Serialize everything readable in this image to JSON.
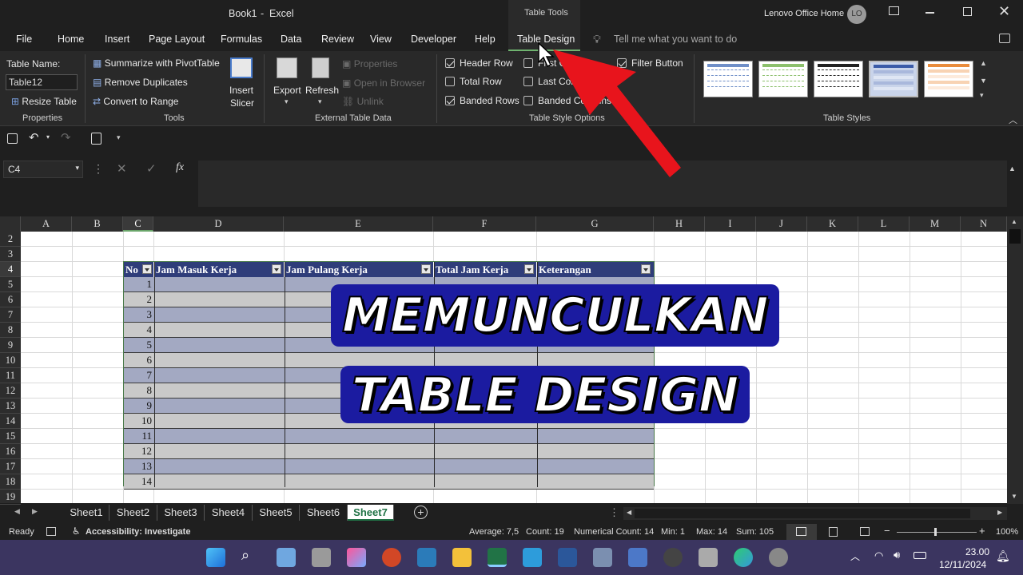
{
  "title": {
    "doc": "Book1",
    "sep": "-",
    "app": "Excel",
    "tools": "Table Tools",
    "account": "Lenovo Office Home",
    "avatar": "LO"
  },
  "menu": [
    "File",
    "Home",
    "Insert",
    "Page Layout",
    "Formulas",
    "Data",
    "Review",
    "View",
    "Developer",
    "Help",
    "Table Design"
  ],
  "tellme": "Tell me what you want to do",
  "ribbon": {
    "table_name_label": "Table Name:",
    "table_name_value": "Table12",
    "resize_table": "Resize Table",
    "summarize": "Summarize with PivotTable",
    "remove_dup": "Remove Duplicates",
    "convert": "Convert to Range",
    "insert_slicer_1": "Insert",
    "insert_slicer_2": "Slicer",
    "export": "Export",
    "refresh": "Refresh",
    "properties": "Properties",
    "open_browser": "Open in Browser",
    "unlink": "Unlink",
    "header_row": "Header Row",
    "total_row": "Total Row",
    "banded_rows": "Banded Rows",
    "first_column": "First Column",
    "last_column": "Last Column",
    "banded_columns": "Banded Columns",
    "filter_button": "Filter Button",
    "groups": {
      "properties": "Properties",
      "tools": "Tools",
      "external": "External Table Data",
      "style_options": "Table Style Options",
      "styles": "Table Styles"
    }
  },
  "namebox": "C4",
  "fx": "fx",
  "columns": [
    "A",
    "B",
    "C",
    "D",
    "E",
    "F",
    "G",
    "H",
    "I",
    "J",
    "K",
    "L",
    "M",
    "N"
  ],
  "rows": [
    "2",
    "3",
    "4",
    "5",
    "6",
    "7",
    "8",
    "9",
    "10",
    "11",
    "12",
    "13",
    "14",
    "15",
    "16",
    "17",
    "18",
    "19"
  ],
  "table": {
    "headers": [
      "No",
      "Jam Masuk Kerja",
      "Jam Pulang Kerja",
      "Total Jam Kerja",
      "Keterangan"
    ],
    "numbers": [
      "1",
      "2",
      "3",
      "4",
      "5",
      "6",
      "7",
      "8",
      "9",
      "10",
      "11",
      "12",
      "13",
      "14"
    ]
  },
  "overlay": {
    "line1": "MEMUNCULKAN",
    "line2": "TABLE DESIGN"
  },
  "sheets": [
    "Sheet1",
    "Sheet2",
    "Sheet3",
    "Sheet4",
    "Sheet5",
    "Sheet6",
    "Sheet7"
  ],
  "active_sheet": "Sheet7",
  "status": {
    "ready": "Ready",
    "accessibility": "Accessibility: Investigate",
    "average": "Average: 7,5",
    "count": "Count: 19",
    "numerical_count": "Numerical Count: 14",
    "min": "Min: 1",
    "max": "Max: 14",
    "sum": "Sum: 105",
    "zoom": "100%"
  },
  "taskbar": {
    "time": "23.00",
    "date": "12/11/2024"
  },
  "colors": {
    "header_blue": "#2f3d7a",
    "band_a": "#a3a9c2",
    "band_b": "#c9c9c9",
    "arrow": "#e8141c",
    "excel_green": "#217346"
  }
}
